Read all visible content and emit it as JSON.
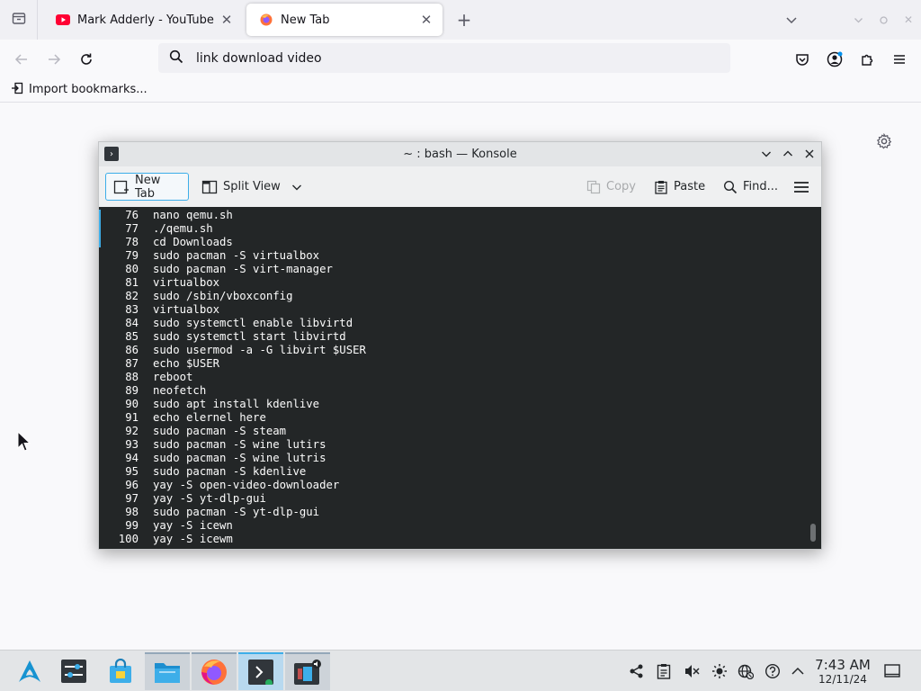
{
  "browser": {
    "tabs": [
      {
        "title": "Mark Adderly - YouTube",
        "active": false,
        "favicon": "youtube-icon"
      },
      {
        "title": "New Tab",
        "active": true,
        "favicon": "firefox-icon"
      }
    ],
    "url_text": "link download video",
    "bookmarks_label": "Import bookmarks..."
  },
  "konsole": {
    "title": "~ : bash — Konsole",
    "toolbar": {
      "new_tab": "New Tab",
      "split_view": "Split View",
      "copy": "Copy",
      "paste": "Paste",
      "find": "Find..."
    },
    "history": [
      {
        "num": "76",
        "cmd": "nano qemu.sh"
      },
      {
        "num": "77",
        "cmd": "./qemu.sh"
      },
      {
        "num": "78",
        "cmd": "cd Downloads"
      },
      {
        "num": "79",
        "cmd": "sudo pacman -S virtualbox"
      },
      {
        "num": "80",
        "cmd": "sudo pacman -S virt-manager"
      },
      {
        "num": "81",
        "cmd": "virtualbox"
      },
      {
        "num": "82",
        "cmd": "sudo /sbin/vboxconfig"
      },
      {
        "num": "83",
        "cmd": "virtualbox"
      },
      {
        "num": "84",
        "cmd": "sudo systemctl enable libvirtd"
      },
      {
        "num": "85",
        "cmd": "sudo systemctl start libvirtd"
      },
      {
        "num": "86",
        "cmd": "sudo usermod -a -G libvirt $USER"
      },
      {
        "num": "87",
        "cmd": "echo $USER"
      },
      {
        "num": "88",
        "cmd": "reboot"
      },
      {
        "num": "89",
        "cmd": "neofetch"
      },
      {
        "num": "90",
        "cmd": "sudo apt install kdenlive"
      },
      {
        "num": "91",
        "cmd": "echo elernel here"
      },
      {
        "num": "92",
        "cmd": "sudo pacman -S steam"
      },
      {
        "num": "93",
        "cmd": "sudo pacman -S wine lutirs"
      },
      {
        "num": "94",
        "cmd": "sudo pacman -S wine lutris"
      },
      {
        "num": "95",
        "cmd": "sudo pacman -S kdenlive"
      },
      {
        "num": "96",
        "cmd": "yay -S open-video-downloader"
      },
      {
        "num": "97",
        "cmd": "yay -S yt-dlp-gui"
      },
      {
        "num": "98",
        "cmd": "sudo pacman -S yt-dlp-gui"
      },
      {
        "num": "99",
        "cmd": "yay -S icewn"
      },
      {
        "num": "100",
        "cmd": "yay -S icewm"
      }
    ]
  },
  "taskbar": {
    "clock_time": "7:43 AM",
    "clock_date": "12/11/24"
  },
  "colors": {
    "accent": "#3daee9",
    "terminal_bg": "#232627",
    "youtube_red": "#ff0033"
  }
}
